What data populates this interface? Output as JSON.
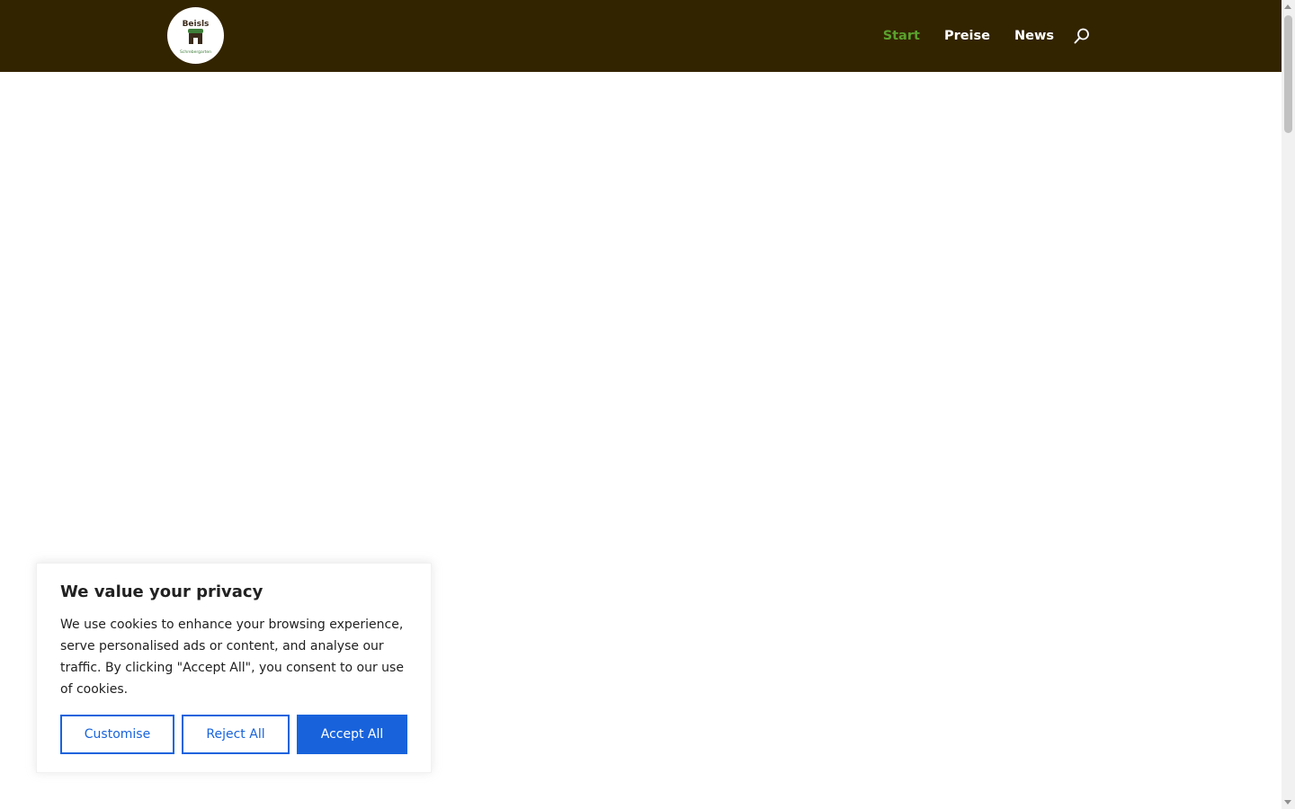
{
  "header": {
    "logo_text": "Beisls",
    "logo_subtext": "Schrebergarten"
  },
  "nav": {
    "items": [
      {
        "label": "Start",
        "active": true
      },
      {
        "label": "Preise",
        "active": false
      },
      {
        "label": "News",
        "active": false
      }
    ],
    "search_icon": "search-icon"
  },
  "cookie_banner": {
    "title": "We value your privacy",
    "body": "We use cookies to enhance your browsing experience, serve personalised ads or content, and analyse our traffic. By clicking \"Accept All\", you consent to our use of cookies.",
    "customise_label": "Customise",
    "reject_label": "Reject All",
    "accept_label": "Accept All"
  },
  "colors": {
    "header_bg": "#332400",
    "nav_active": "#5aa12e",
    "accent": "#1863dc"
  }
}
